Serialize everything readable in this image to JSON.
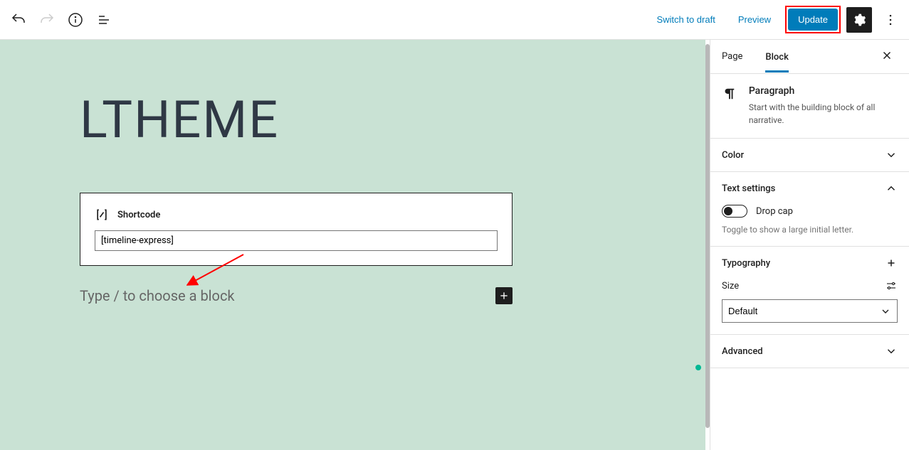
{
  "toolbar": {
    "switch_draft": "Switch to draft",
    "preview": "Preview",
    "update": "Update"
  },
  "canvas": {
    "title": "LTHEME",
    "shortcode_label": "Shortcode",
    "shortcode_value": "[timeline-express]",
    "placeholder": "Type / to choose a block"
  },
  "sidebar": {
    "tabs": {
      "page": "Page",
      "block": "Block"
    },
    "block_info": {
      "name": "Paragraph",
      "desc": "Start with the building block of all narrative."
    },
    "panels": {
      "color": "Color",
      "text_settings": "Text settings",
      "drop_cap": "Drop cap",
      "drop_cap_help": "Toggle to show a large initial letter.",
      "typography": "Typography",
      "size": "Size",
      "size_value": "Default",
      "advanced": "Advanced"
    }
  }
}
